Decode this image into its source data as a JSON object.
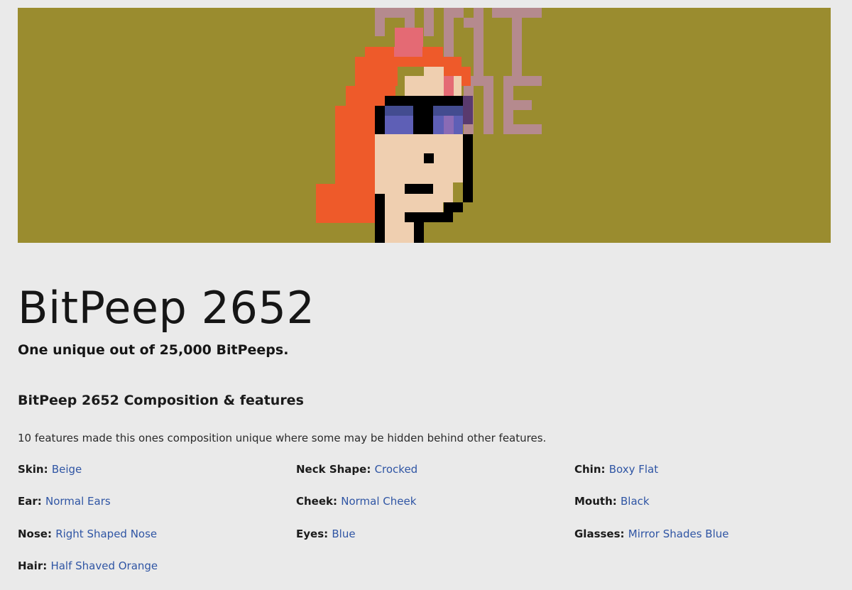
{
  "banner": {
    "background_color": "#9a8c2f",
    "hair_color": "#ee5a2a",
    "skin_color": "#efcfb0",
    "lens_color": "#5e5fb6",
    "watermark_color": "#b58a8e"
  },
  "header": {
    "title": "BitPeep 2652",
    "subtitle": "One unique out of 25,000 BitPeeps."
  },
  "composition": {
    "heading": "BitPeep 2652 Composition & features",
    "description": "10 features made this ones composition unique where some may be hidden behind other features.",
    "features": [
      {
        "name": "Skin:",
        "value": "Beige"
      },
      {
        "name": "Neck Shape:",
        "value": "Crocked"
      },
      {
        "name": "Chin:",
        "value": "Boxy Flat"
      },
      {
        "name": "Ear:",
        "value": "Normal Ears"
      },
      {
        "name": "Cheek:",
        "value": "Normal Cheek"
      },
      {
        "name": "Mouth:",
        "value": "Black"
      },
      {
        "name": "Nose:",
        "value": "Right Shaped Nose"
      },
      {
        "name": "Eyes:",
        "value": "Blue"
      },
      {
        "name": "Glasses:",
        "value": "Mirror Shades Blue"
      },
      {
        "name": "Hair:",
        "value": "Half Shaved Orange"
      }
    ]
  },
  "colors": {
    "link": "#2f55a4",
    "page_background": "#eaeaea"
  }
}
